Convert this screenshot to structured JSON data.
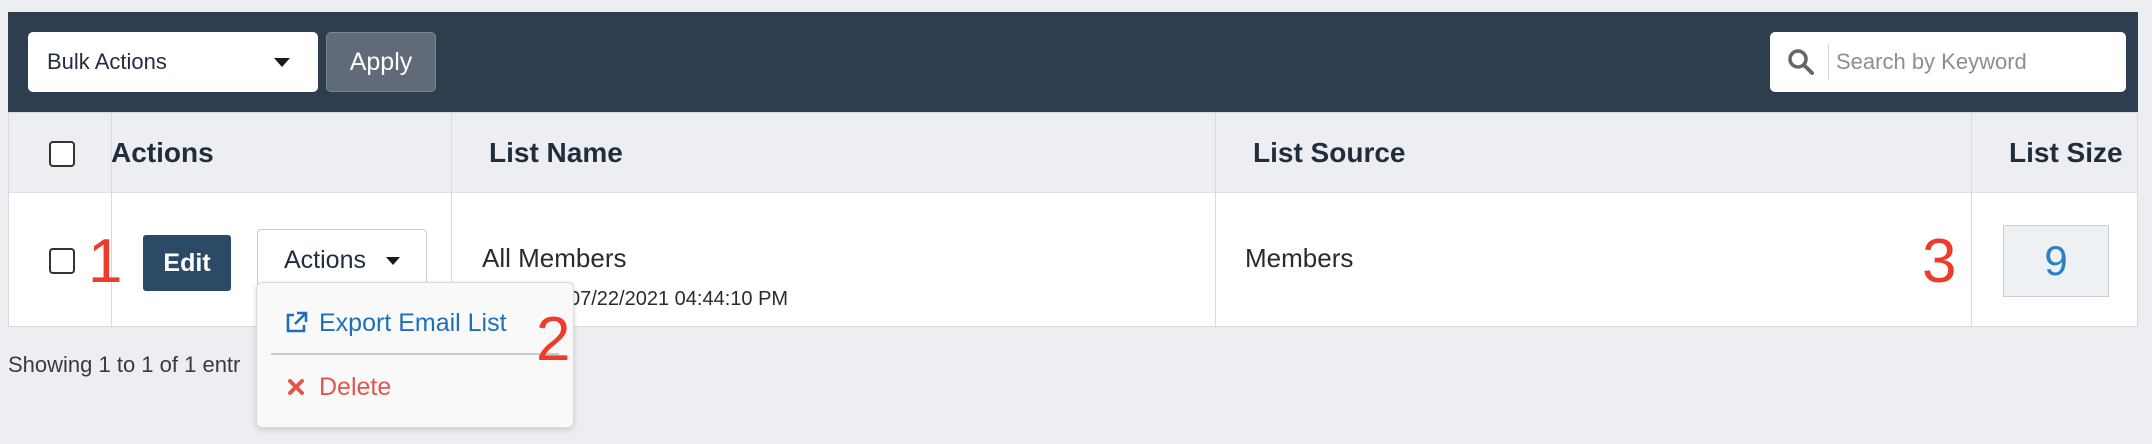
{
  "toolbar": {
    "bulk_actions_label": "Bulk Actions",
    "apply_label": "Apply",
    "search_placeholder": "Search by Keyword",
    "background": "#2f3e4f"
  },
  "table": {
    "headers": {
      "actions": "Actions",
      "list_name": "List Name",
      "list_source": "List Source",
      "list_size": "List Size"
    },
    "rows": [
      {
        "edit_label": "Edit",
        "actions_label": "Actions",
        "list_name": "All Members",
        "date": "07/22/2021 04:44:10 PM",
        "list_source": "Members",
        "list_size": "9"
      }
    ]
  },
  "dropdown": {
    "export_label": "Export Email List",
    "delete_label": "Delete",
    "export_color": "#1e6fb8",
    "delete_color": "#e0584b"
  },
  "footer": {
    "showing_text": "Showing 1 to 1 of 1 entr"
  },
  "annotations": {
    "one": "1",
    "two": "2",
    "three": "3",
    "color": "#ee3b2a"
  }
}
